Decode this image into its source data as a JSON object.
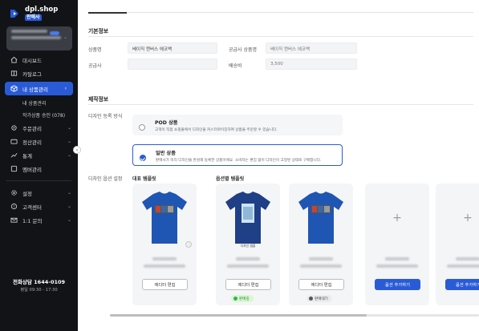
{
  "brand": {
    "name": "dpl.shop",
    "badge": "판매사",
    "accent": "#2a5bd7"
  },
  "sidebar": {
    "items": [
      {
        "label": "대시보드",
        "icon": "home-icon"
      },
      {
        "label": "카탈로그",
        "icon": "book-icon"
      },
      {
        "label": "내 상품관리",
        "icon": "box-icon",
        "active": true
      },
      {
        "label": "주문관리",
        "icon": "gear-icon"
      },
      {
        "label": "정산관리",
        "icon": "wallet-icon"
      },
      {
        "label": "통계",
        "icon": "chart-icon"
      },
      {
        "label": "멤버관리",
        "icon": "member-icon"
      }
    ],
    "sub_items": [
      "내 상품관리",
      "작가상품 승인 (078)"
    ],
    "bottom_items": [
      {
        "label": "설정",
        "icon": "settings-icon"
      },
      {
        "label": "고객센터",
        "icon": "help-icon"
      },
      {
        "label": "1:1 문의",
        "icon": "mail-icon"
      }
    ],
    "cs": {
      "title": "전화상담 1644-0109",
      "hours": "평일 09:30 - 17:30"
    }
  },
  "basic_info": {
    "title": "기본정보",
    "product_name_label": "상품명",
    "product_name_value": "베이직 캔버스 에코백",
    "supplier_product_label": "공급사 상품명",
    "supplier_product_value": "베이직 캔버스 에코백",
    "supplier_label": "공급사",
    "shipping_label": "배송비",
    "shipping_value": "3,500"
  },
  "production_info": {
    "title": "제작정보",
    "method_label": "디자인 등록 방식",
    "pod": {
      "title": "POD 상품",
      "desc": "고객이 직접 쇼핑몰에서 디자인을 커스터마이징하여 상품을 주문할 수 있습니다."
    },
    "normal": {
      "title": "일반 상품",
      "desc": "판매사가 미리 디자인을 완성해 등록한 상품이에요. 소비자는 편집 없이 디자인이 고정된 상태로 구매합니다."
    },
    "option_label": "디자인 옵션 설정",
    "rep_template_label": "대표 템플릿",
    "option_template_label": "옵션별 템플릿"
  },
  "templates": [
    {
      "kind": "shirt",
      "color": "#1f56b3",
      "button": "에디터 편집"
    },
    {
      "kind": "shirt",
      "color": "#1f3f86",
      "button": "에디터 편집",
      "status": "판매중",
      "caption": "디자인 샘플"
    },
    {
      "kind": "shirt",
      "color": "#1f56b3",
      "button": "에디터 편집",
      "status": "판매대기"
    },
    {
      "kind": "add",
      "button": "옵션 추가하기"
    },
    {
      "kind": "add",
      "button": "옵션 추가하기"
    }
  ]
}
